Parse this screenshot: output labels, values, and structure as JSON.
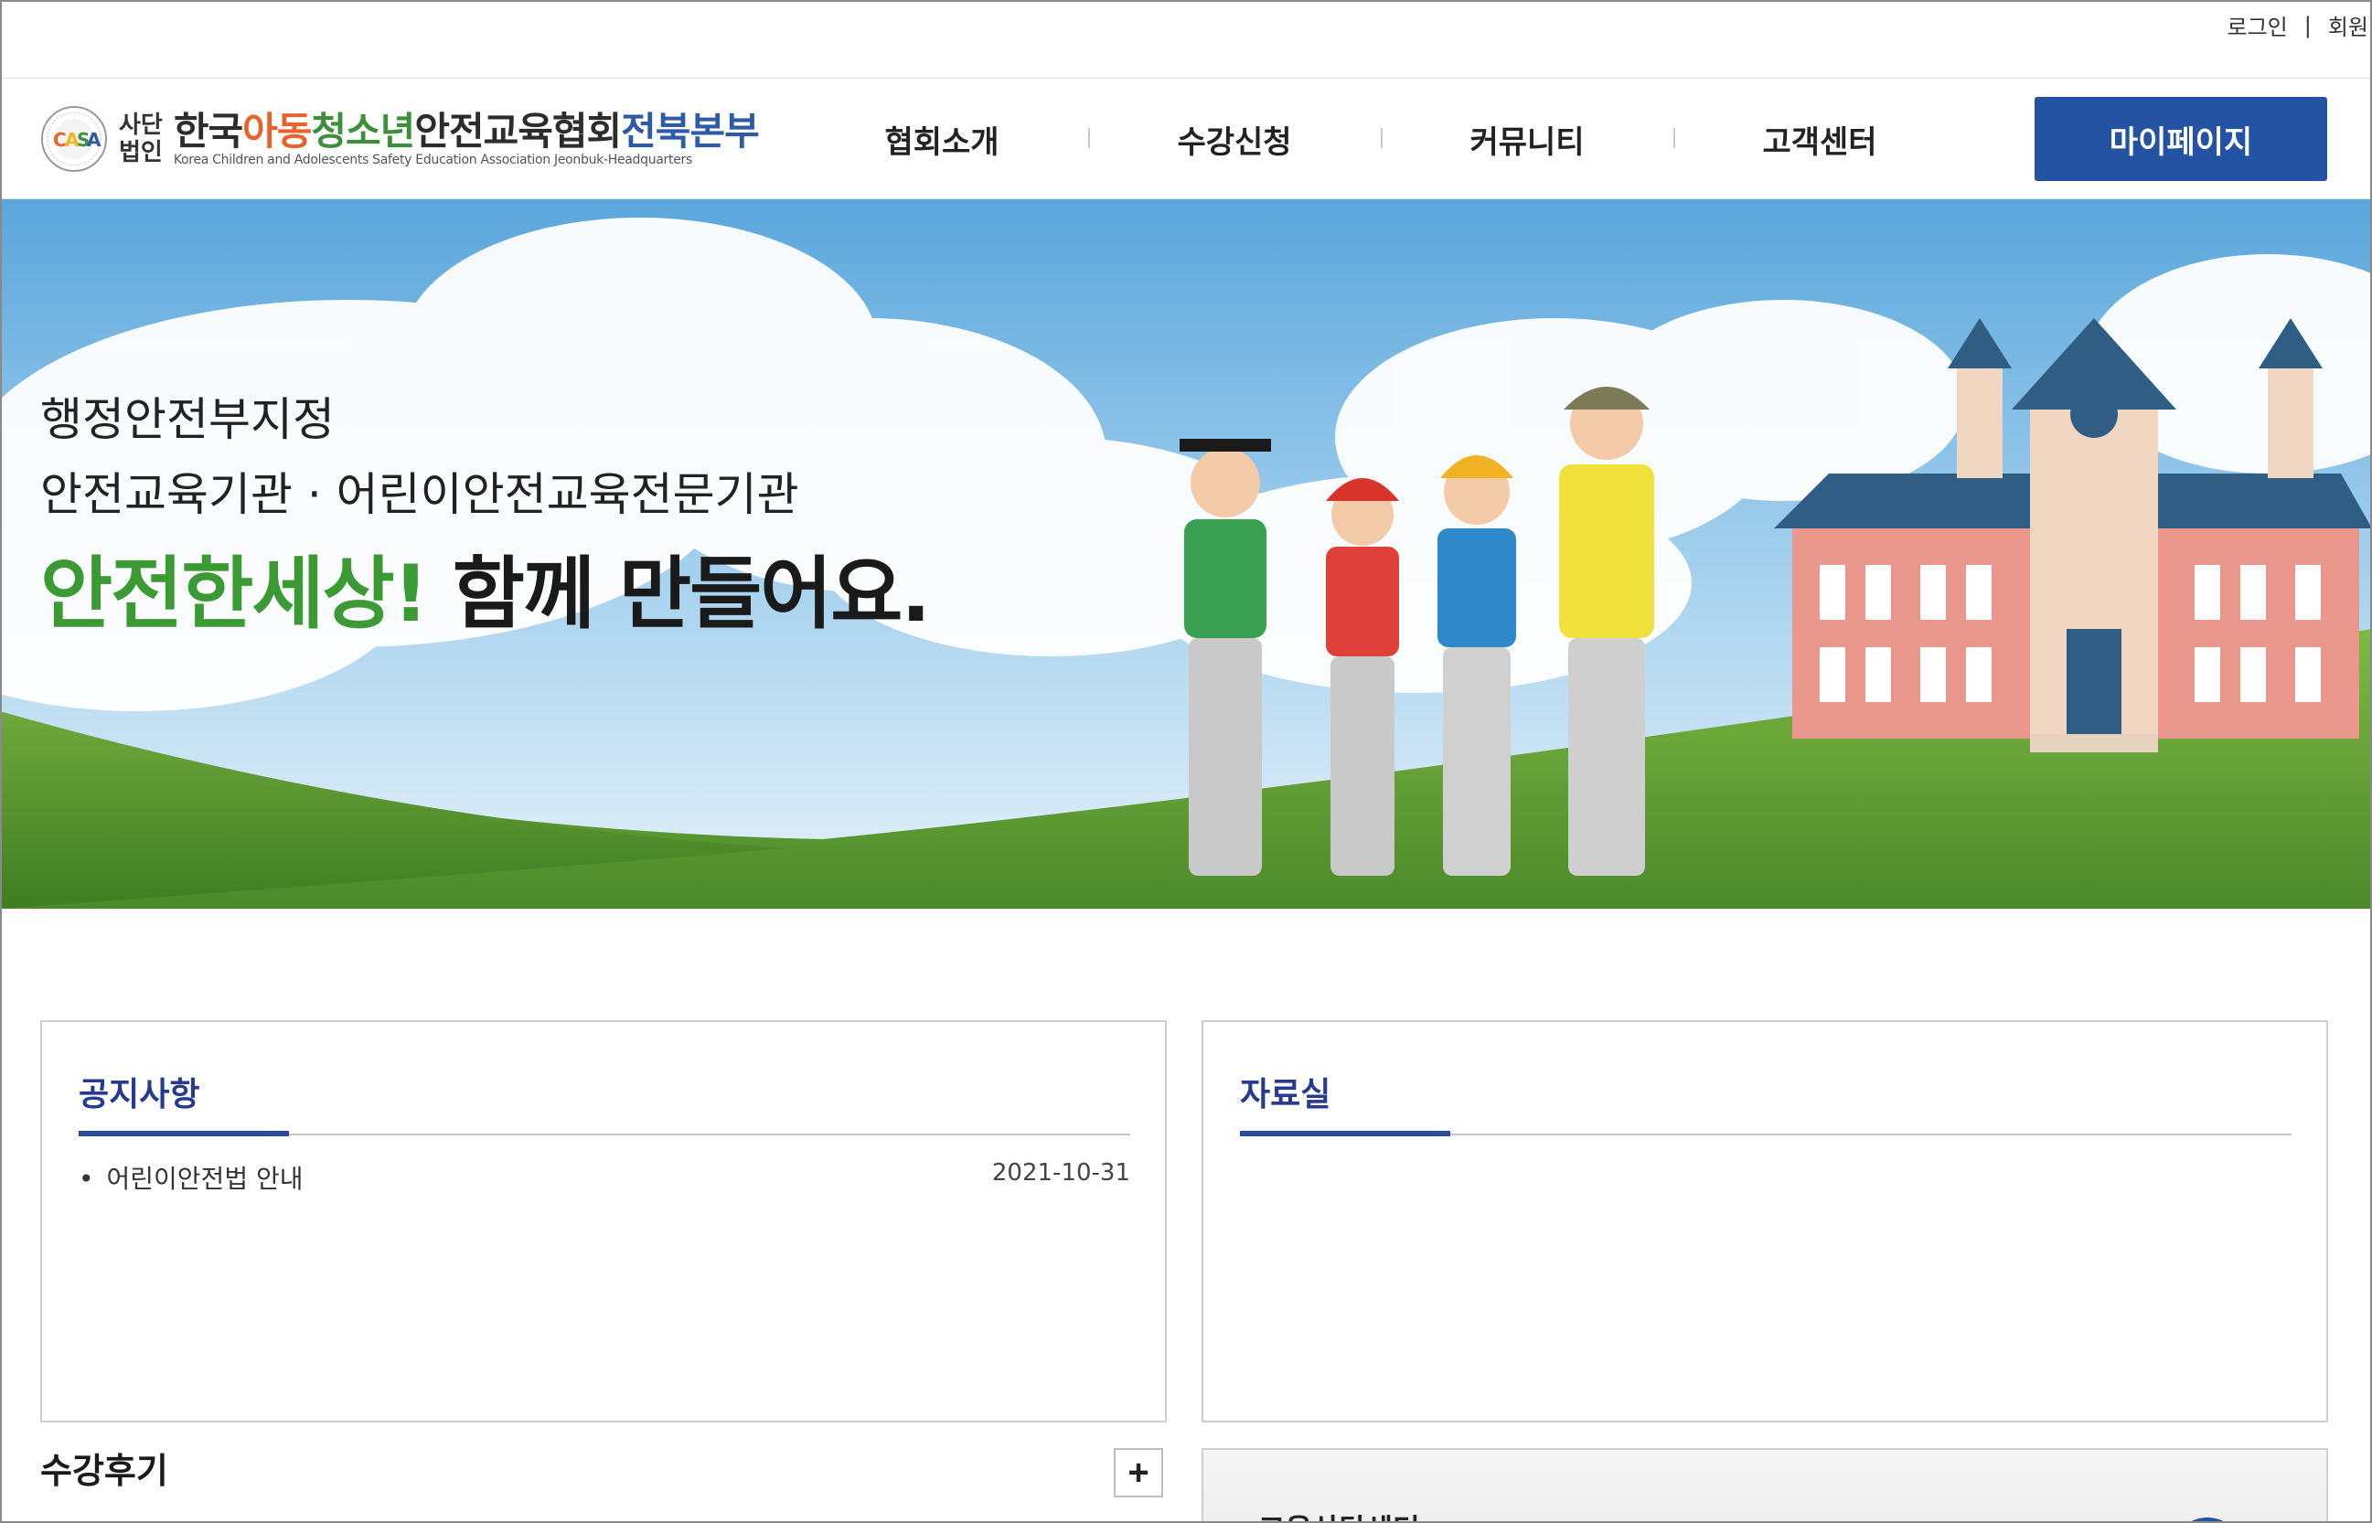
{
  "topbar": {
    "login": "로그인",
    "separator": "|",
    "member": "회원"
  },
  "header": {
    "logo": {
      "corp_line1": "사단",
      "corp_line2": "법인",
      "title_part1": "한국",
      "title_part2": "아동",
      "title_part3": "청소년",
      "title_part4": "안전교육협회",
      "title_part5": "전북본부",
      "subtitle": "Korea Children and Adolescents Safety Education Association Jeonbuk-Headquarters",
      "emblem_text": "CASA"
    },
    "nav": [
      "협회소개",
      "수강신청",
      "커뮤니티",
      "고객센터"
    ],
    "mypage": "마이페이지"
  },
  "hero": {
    "line1": "행정안전부지정",
    "line2": "안전교육기관 · 어린이안전교육전문기관",
    "slogan_green": "안전한세상!",
    "slogan_black": " 함께 만들어요."
  },
  "notice": {
    "title": "공지사항",
    "items": [
      {
        "text": "어린이안전법 안내",
        "date": "2021-10-31"
      }
    ]
  },
  "archive": {
    "title": "자료실"
  },
  "review": {
    "title": "수강후기",
    "more": "+"
  },
  "consult": {
    "title": "교육상담센터"
  },
  "colors": {
    "primary": "#2553a3",
    "board_title": "#263a91",
    "slogan_green": "#3c9a35"
  }
}
